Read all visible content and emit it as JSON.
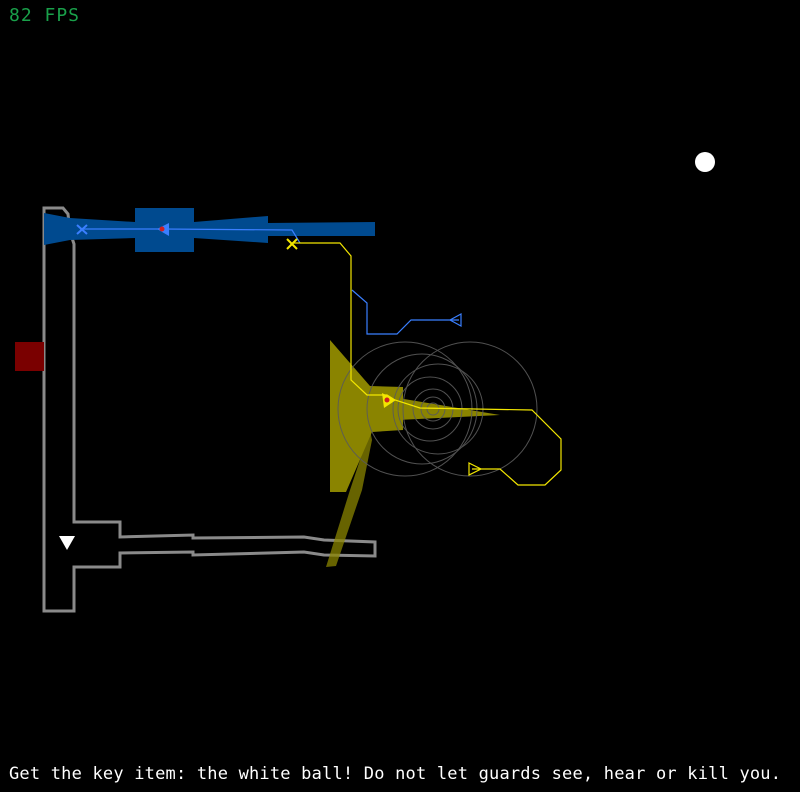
{
  "hud": {
    "fps_text": "82 FPS",
    "fps_color": "#19a04a",
    "objective_text": "Get the key item: the white ball! Do not let guards see, hear or kill you."
  },
  "colors": {
    "background": "#000000",
    "corridor_outline": "#8a8a8a",
    "guard_blue_vision": "#004a8f",
    "guard_blue_path": "#3a7fff",
    "guard_yellow_vision": "#8a8400",
    "guard_yellow_path": "#f2e600",
    "sound_rings": "#5a5a5a",
    "door_block": "#7a0000",
    "key_item": "#ffffff",
    "player": "#ffffff",
    "alert_marker": "#d02020"
  },
  "entities": {
    "player": "player-triangle-icon",
    "key_item": "white-ball-key-item",
    "guard_blue": "blue-guard-icon",
    "guard_yellow": "yellow-guard-icon",
    "waypoint_marker": "x-waypoint-icon"
  }
}
